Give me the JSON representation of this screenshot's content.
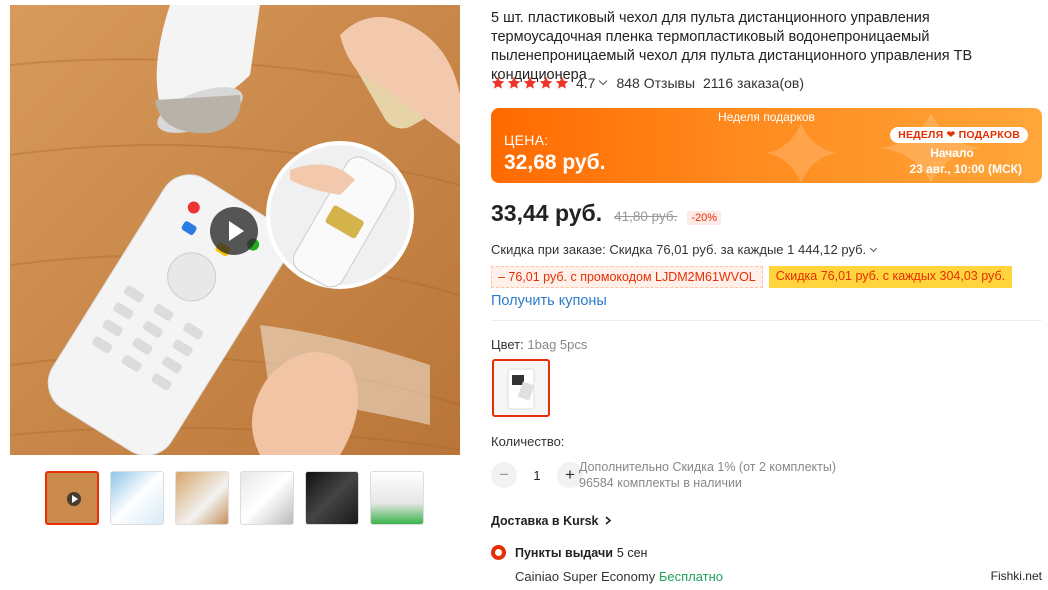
{
  "product": {
    "title": "5 шт. пластиковый чехол для пульта дистанционного управления термоусадочная пленка термопластиковый водонепроницаемый пыленепроницаемый чехол для пульта дистанционного управления ТВ кондиционера",
    "rating": "4.7",
    "stars": 5,
    "reviews": "848 Отзывы",
    "orders": "2116 заказа(ов)"
  },
  "promo": {
    "event": "Неделя подарков",
    "label": "ЦЕНА:",
    "price": "32,68 руб.",
    "badge": "НЕДЕЛЯ ❤ ПОДАРКОВ",
    "start_label": "Начало",
    "start_date": "23 авг., 10:00 (МСК)"
  },
  "pricing": {
    "price": "33,44 руб.",
    "old_price": "41,80 руб.",
    "discount": "-20%",
    "order_discount": "Скидка при заказе: Скидка 76,01 руб. за каждые 1 444,12 руб.",
    "promo_code": "– 76,01 руб. с промокодом LJDM2M61WVOL",
    "store_discount": "Скидка 76,01 руб. с каждых 304,03 руб.",
    "get_coupons": "Получить купоны"
  },
  "options": {
    "color_label": "Цвет:",
    "color_value": "1bag 5pcs",
    "quantity_label": "Количество:",
    "quantity": "1",
    "minus": "−",
    "plus": "+",
    "extra_discount": "Дополнительно Скидка 1% (от 2 комплекты)",
    "stock": "96584 комплекты в наличии"
  },
  "delivery": {
    "title": "Доставка в Kursk",
    "pickup_label": "Пункты выдачи",
    "pickup_time": "5 сен",
    "carrier": "Cainiao Super Economy",
    "cost": "Бесплатно"
  },
  "watermark": "Fishki.net",
  "colors": {
    "accent": "#e62e04",
    "promo_orange": "#ff6a00",
    "link_blue": "#2b7ccc",
    "free_green": "#21a05a"
  },
  "icons": {
    "play": "play-icon",
    "star": "star-icon",
    "chevron": "chevron-down-icon"
  }
}
